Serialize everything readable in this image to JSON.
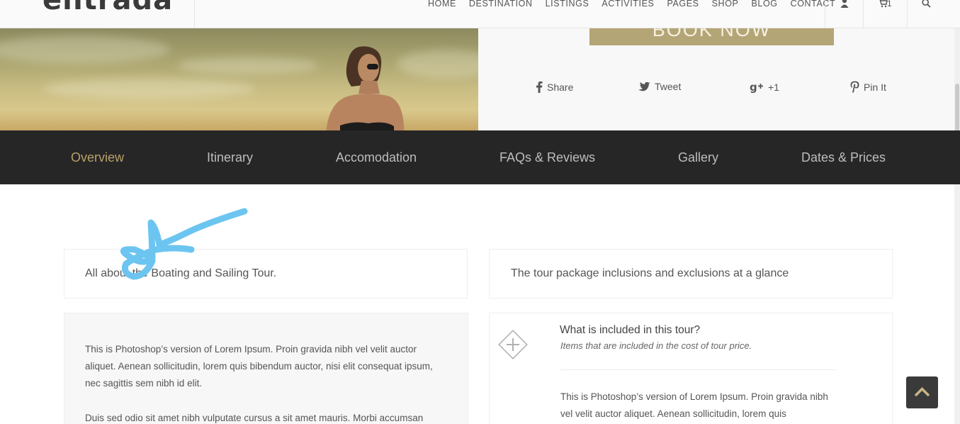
{
  "header": {
    "logo": "entrada",
    "nav": [
      "HOME",
      "DESTINATION",
      "LISTINGS",
      "ACTIVITIES",
      "PAGES",
      "SHOP",
      "BLOG",
      "CONTACT"
    ],
    "cart_count": "1",
    "user_icon": "user-icon",
    "cart_icon": "cart-icon",
    "search_icon": "search-icon"
  },
  "hero": {
    "book_label": "BOOK NOW",
    "share": [
      {
        "label": "Share",
        "icon": "facebook-icon"
      },
      {
        "label": "Tweet",
        "icon": "twitter-icon"
      },
      {
        "label": "+1",
        "icon": "google-plus-icon"
      },
      {
        "label": "Pin It",
        "icon": "pinterest-icon"
      }
    ]
  },
  "tabs": [
    "Overview",
    "Itinerary",
    "Accomodation",
    "FAQs & Reviews",
    "Gallery",
    "Dates & Prices"
  ],
  "active_tab": "Overview",
  "overview": {
    "title": "All about the Boating and Sailing Tour.",
    "para1": "This is Photoshop’s version of Lorem Ipsum. Proin gravida nibh vel velit auctor aliquet. Aenean sollicitudin, lorem quis bibendum auctor, nisi elit consequat ipsum, nec sagittis sem nibh id elit.",
    "para2": "Duis sed odio sit amet nibh vulputate cursus a sit amet mauris. Morbi accumsan"
  },
  "inclusions": {
    "title": "The tour package inclusions and exclusions at a glance",
    "included_title": "What is included in this tour?",
    "included_sub": "Items that are included in the cost of tour price.",
    "included_text": "This is Photoshop’s version of Lorem Ipsum. Proin gravida nibh vel velit auctor aliquet. Aenean sollicitudin, lorem quis"
  },
  "colors": {
    "accent": "#b8a06a",
    "tab_bar": "#262626",
    "book_button": "#b3a575",
    "scribble": "#6cc5f0"
  },
  "back_to_top_icon": "chevron-up-icon"
}
